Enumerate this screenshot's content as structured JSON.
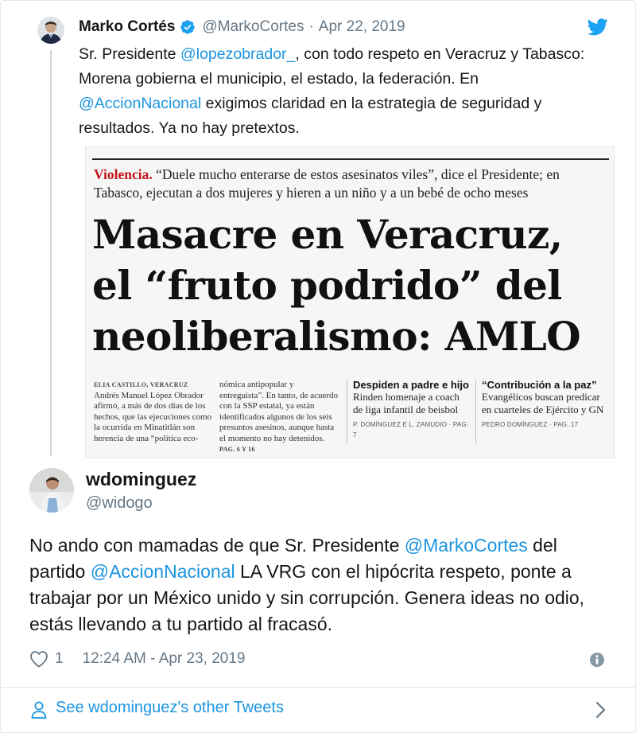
{
  "parent_tweet": {
    "author_name": "Marko Cortés",
    "handle": "@MarkoCortes",
    "separator": "·",
    "date": "Apr 22, 2019",
    "text": {
      "t1": "Sr. Presidente ",
      "mention1": "@lopezobrador_",
      "t2": ", con todo respeto en Veracruz y Tabasco: Morena gobierna el municipio, el estado, la federación. En ",
      "mention2": "@AccionNacional",
      "t3": " exigimos claridad en la estrategia de seguridad y resultados. Ya no hay pretextos."
    },
    "newspaper": {
      "kicker_label": "Violencia.",
      "kicker_text": " “Duele mucho enterarse de estos asesinatos viles”, dice el Presidente; en Tabasco, ejecutan a dos mujeres y hieren a un niño y a un bebé de ocho meses",
      "headline_l1": "Masacre en Veracruz,",
      "headline_l2": "el “fruto podrido” del",
      "headline_l3": "neoliberalismo: AMLO",
      "col1_byline": "ELIA CASTILLO, VERACRUZ",
      "col1_text": "Andrés Manuel López Obrador afirmó, a más de dos días de los hechos, que las ejecuciones como la ocurrida en Minatitlán son herencia de una “política eco-",
      "col2_text": "nómica antipopular y entreguista”. En tanto, de acuerdo con la SSP estatal, ya están identificados algunos de los seis presuntos asesinos, aunque hasta el momento no hay detenidos.",
      "col2_page": " PAG. 6 Y 16",
      "box1_title": "Despiden a padre e hijo",
      "box1_text": "Rinden homenaje a coach de liga infantil de beisbol",
      "box1_by": "P. DOMÍNGUEZ E L. ZAMUDIO · PAG. 7",
      "box2_title": "“Contribución a la paz”",
      "box2_text": "Evangélicos buscan predicar en cuarteles de Ejército y GN",
      "box2_by": "PEDRO DOMÍNGUEZ · PAG. 17"
    }
  },
  "reply_tweet": {
    "author_name": "wdominguez",
    "handle": "@widogo",
    "text": {
      "t1": "No ando con mamadas de que Sr. Presidente ",
      "mention1": "@MarkoCortes",
      "t2": " del partido ",
      "mention2": "@AccionNacional",
      "t3": "  LA VRG con el hipócrita respeto, ponte a trabajar por un México unido y sin corrupción. Genera ideas no odio, estás llevando a tu partido al fracasó."
    },
    "likes": "1",
    "timestamp": "12:24 AM - Apr 23, 2019"
  },
  "footer": {
    "see_more": "See wdominguez's other Tweets"
  },
  "colors": {
    "link": "#1b95e0",
    "muted": "#657786",
    "headline_red": "#c3151b",
    "border": "#e1e8ed"
  },
  "icons": [
    "verified-badge-icon",
    "twitter-bird-icon",
    "heart-icon",
    "info-icon",
    "person-icon",
    "chevron-right-icon"
  ]
}
